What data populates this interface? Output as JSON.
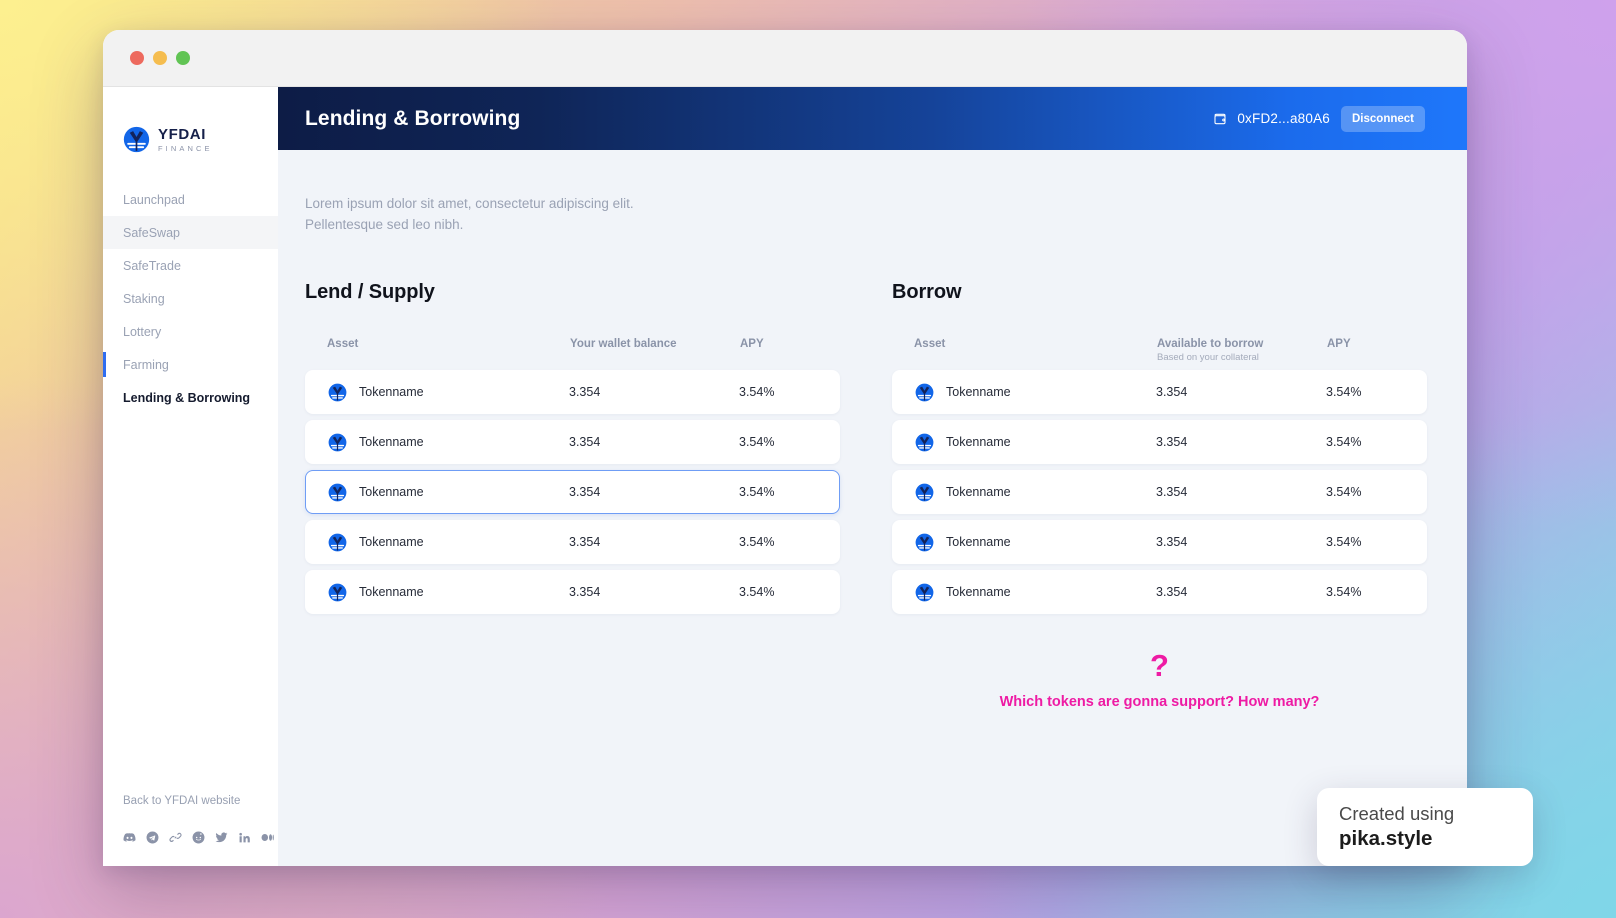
{
  "window": {
    "traffic_lights": [
      "close",
      "minimize",
      "maximize"
    ]
  },
  "sidebar": {
    "logo": {
      "name": "YFDAI",
      "subtitle": "FINANCE"
    },
    "items": [
      {
        "label": "Launchpad",
        "state": "default"
      },
      {
        "label": "SafeSwap",
        "state": "hover"
      },
      {
        "label": "SafeTrade",
        "state": "default"
      },
      {
        "label": "Staking",
        "state": "default"
      },
      {
        "label": "Lottery",
        "state": "default"
      },
      {
        "label": "Farming",
        "state": "marked"
      },
      {
        "label": "Lending & Borrowing",
        "state": "active"
      }
    ],
    "back_link": "Back to YFDAI website",
    "socials": [
      "discord-icon",
      "telegram-icon",
      "link-icon",
      "reddit-icon",
      "twitter-icon",
      "linkedin-icon",
      "medium-icon"
    ]
  },
  "header": {
    "title": "Lending & Borrowing",
    "wallet_icon": "wallet-icon",
    "wallet_address": "0xFD2...a80A6",
    "disconnect_label": "Disconnect",
    "gradient_from": "#0d1c46",
    "gradient_to": "#1e77fb"
  },
  "content": {
    "intro_line_1": "Lorem ipsum dolor sit amet, consectetur adipiscing elit.",
    "intro_line_2": "Pellentesque sed leo nibh."
  },
  "lend_panel": {
    "title": "Lend / Supply",
    "columns": {
      "asset": "Asset",
      "value": "Your wallet balance",
      "value_sub": "",
      "apy": "APY"
    },
    "rows": [
      {
        "icon": "token-icon",
        "name": "Tokenname",
        "value": "3.354",
        "apy": "3.54%",
        "selected": false
      },
      {
        "icon": "token-icon",
        "name": "Tokenname",
        "value": "3.354",
        "apy": "3.54%",
        "selected": false
      },
      {
        "icon": "token-icon",
        "name": "Tokenname",
        "value": "3.354",
        "apy": "3.54%",
        "selected": true
      },
      {
        "icon": "token-icon",
        "name": "Tokenname",
        "value": "3.354",
        "apy": "3.54%",
        "selected": false
      },
      {
        "icon": "token-icon",
        "name": "Tokenname",
        "value": "3.354",
        "apy": "3.54%",
        "selected": false
      }
    ]
  },
  "borrow_panel": {
    "title": "Borrow",
    "columns": {
      "asset": "Asset",
      "value": "Available to borrow",
      "value_sub": "Based on your collateral",
      "apy": "APY"
    },
    "rows": [
      {
        "icon": "token-icon",
        "name": "Tokenname",
        "value": "3.354",
        "apy": "3.54%",
        "selected": false
      },
      {
        "icon": "token-icon",
        "name": "Tokenname",
        "value": "3.354",
        "apy": "3.54%",
        "selected": false
      },
      {
        "icon": "token-icon",
        "name": "Tokenname",
        "value": "3.354",
        "apy": "3.54%",
        "selected": false
      },
      {
        "icon": "token-icon",
        "name": "Tokenname",
        "value": "3.354",
        "apy": "3.54%",
        "selected": false
      },
      {
        "icon": "token-icon",
        "name": "Tokenname",
        "value": "3.354",
        "apy": "3.54%",
        "selected": false
      }
    ],
    "annotation": {
      "marker": "?",
      "text": "Which tokens are gonna support? How many?",
      "color": "#ee1ba4"
    }
  },
  "watermark": {
    "line1": "Created using",
    "line2": "pika.style"
  }
}
